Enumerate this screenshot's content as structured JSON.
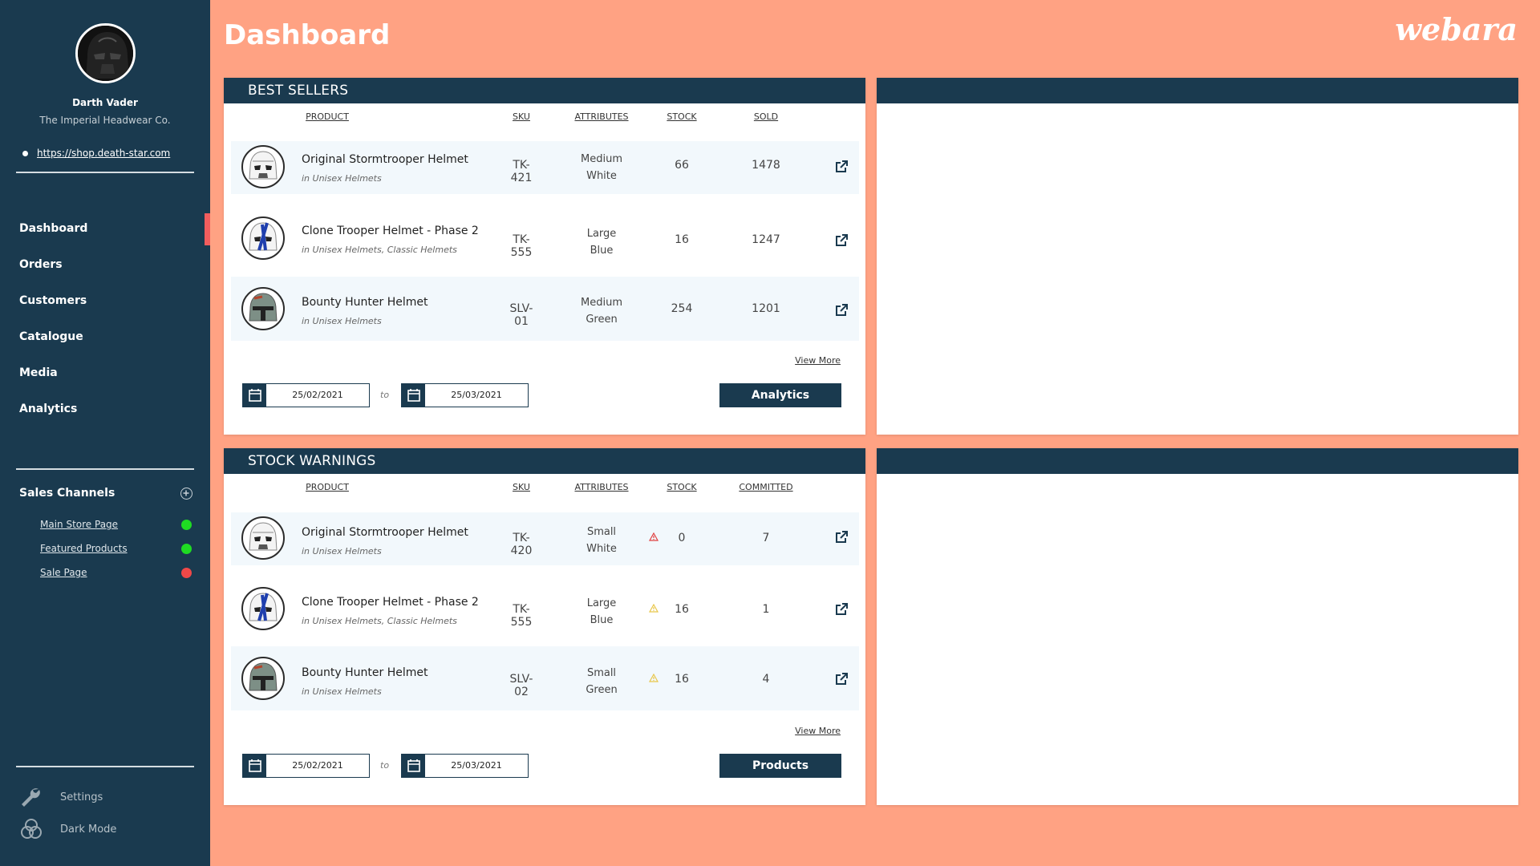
{
  "app": {
    "page_title": "Dashboard",
    "brand": "webara"
  },
  "user": {
    "name": "Darth Vader",
    "company": "The Imperial Headwear Co.",
    "shop_url": "https://shop.death-star.com"
  },
  "nav": {
    "items": [
      {
        "label": "Dashboard",
        "active": true
      },
      {
        "label": "Orders"
      },
      {
        "label": "Customers"
      },
      {
        "label": "Catalogue"
      },
      {
        "label": "Media"
      },
      {
        "label": "Analytics"
      }
    ]
  },
  "channels": {
    "title": "Sales Channels",
    "items": [
      {
        "label": "Main Store Page",
        "status_color": "#1FDB23"
      },
      {
        "label": "Featured Products",
        "status_color": "#1FDB23"
      },
      {
        "label": "Sale Page",
        "status_color": "#F04848"
      }
    ]
  },
  "bottom": {
    "settings": "Settings",
    "dark_mode": "Dark Mode"
  },
  "best_sellers": {
    "title": "BEST SELLERS",
    "columns": {
      "product": "PRODUCT",
      "sku": "SKU",
      "attributes": "ATTRIBUTES",
      "stock": "STOCK",
      "last": "SOLD"
    },
    "rows": [
      {
        "name": "Original Stormtrooper Helmet",
        "category": "in Unisex Helmets",
        "sku": "TK-421",
        "attr1": "Medium",
        "attr2": "White",
        "stock": "66",
        "last": "1478",
        "helmet": "stormtrooper"
      },
      {
        "name": "Clone Trooper Helmet - Phase 2",
        "category": "in Unisex Helmets, Classic Helmets",
        "sku": "TK-555",
        "attr1": "Large",
        "attr2": "Blue",
        "stock": "16",
        "last": "1247",
        "helmet": "clone"
      },
      {
        "name": "Bounty Hunter Helmet",
        "category": "in Unisex Helmets",
        "sku": "SLV-01",
        "attr1": "Medium",
        "attr2": "Green",
        "stock": "254",
        "last": "1201",
        "helmet": "bounty"
      }
    ],
    "view_more": "View More",
    "date_from": "25/02/2021",
    "date_to_label": "to",
    "date_to": "25/03/2021",
    "button": "Analytics"
  },
  "stock_warnings": {
    "title": "STOCK WARNINGS",
    "columns": {
      "product": "PRODUCT",
      "sku": "SKU",
      "attributes": "ATTRIBUTES",
      "stock": "STOCK",
      "last": "COMMITTED"
    },
    "rows": [
      {
        "name": "Original Stormtrooper Helmet",
        "category": "in Unisex Helmets",
        "sku": "TK-420",
        "attr1": "Small",
        "attr2": "White",
        "stock": "0",
        "last": "7",
        "warning": "red",
        "helmet": "stormtrooper"
      },
      {
        "name": "Clone Trooper Helmet - Phase 2",
        "category": "in Unisex Helmets, Classic Helmets",
        "sku": "TK-555",
        "attr1": "Large",
        "attr2": "Blue",
        "stock": "16",
        "last": "1",
        "warning": "yellow",
        "helmet": "clone"
      },
      {
        "name": "Bounty Hunter Helmet",
        "category": "in Unisex Helmets",
        "sku": "SLV-02",
        "attr1": "Small",
        "attr2": "Green",
        "stock": "16",
        "last": "4",
        "warning": "yellow",
        "helmet": "bounty"
      }
    ],
    "view_more": "View More",
    "date_from": "25/02/2021",
    "date_to_label": "to",
    "date_to": "25/03/2021",
    "button": "Products"
  },
  "colors": {
    "sidebar": "#1A3A4F",
    "background": "#FFA283",
    "accent": "#F25D5D",
    "row_alt": "#F2F8FC",
    "warn_red": "#E04040",
    "warn_yellow": "#E8C64A"
  }
}
